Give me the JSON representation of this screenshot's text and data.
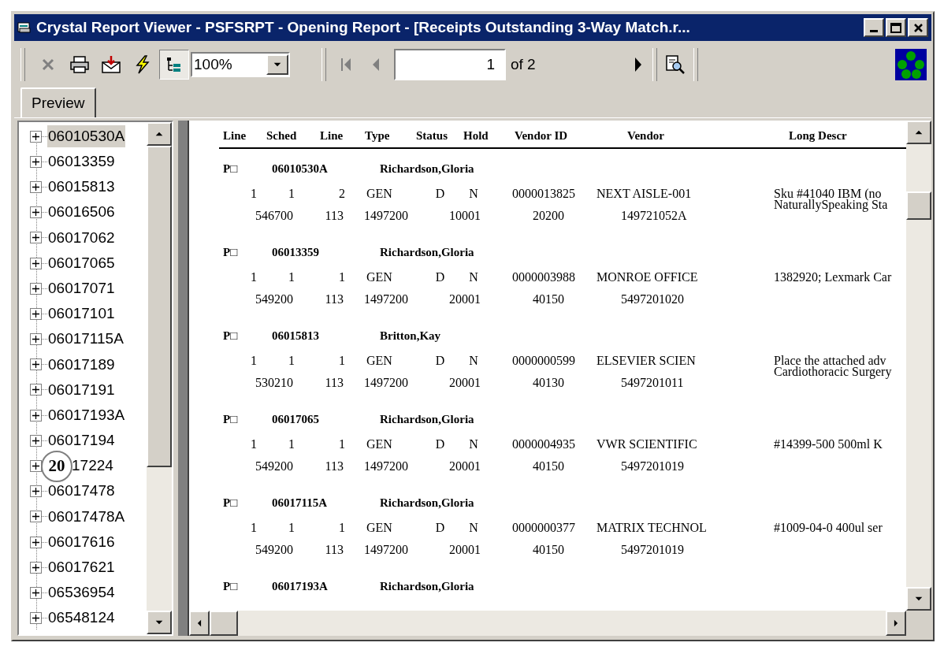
{
  "window": {
    "title": "Crystal Report Viewer - PSFSRPT - Opening Report - [Receipts Outstanding 3-Way Match.r..."
  },
  "toolbar": {
    "buttons": [
      {
        "kind": "close",
        "disabled": true,
        "pressed": false
      },
      {
        "kind": "print",
        "disabled": false,
        "pressed": false
      },
      {
        "kind": "export",
        "disabled": false,
        "pressed": false
      },
      {
        "kind": "refresh",
        "disabled": false,
        "pressed": false
      },
      {
        "kind": "tree",
        "disabled": false,
        "pressed": true
      }
    ],
    "zoom": "100%",
    "first_disabled": true,
    "prev_disabled": true,
    "page": "1",
    "page_count": "of 2",
    "next_disabled": false
  },
  "tabs": [
    {
      "label": "Preview",
      "selected": true
    }
  ],
  "tree": {
    "items": [
      {
        "label": "06010530A",
        "selected": true
      },
      {
        "label": "06013359",
        "selected": false
      },
      {
        "label": "06015813",
        "selected": false
      },
      {
        "label": "06016506",
        "selected": false
      },
      {
        "label": "06017062",
        "selected": false
      },
      {
        "label": "06017065",
        "selected": false
      },
      {
        "label": "06017071",
        "selected": false
      },
      {
        "label": "06017101",
        "selected": false
      },
      {
        "label": "06017115A",
        "selected": false
      },
      {
        "label": "06017189",
        "selected": false
      },
      {
        "label": "06017191",
        "selected": false
      },
      {
        "label": "06017193A",
        "selected": false
      },
      {
        "label": "06017194",
        "selected": false
      },
      {
        "label": "17224",
        "selected": false,
        "callout": "20"
      },
      {
        "label": "06017478",
        "selected": false
      },
      {
        "label": "06017478A",
        "selected": false
      },
      {
        "label": "06017616",
        "selected": false
      },
      {
        "label": "06017621",
        "selected": false
      },
      {
        "label": "06536954",
        "selected": false
      },
      {
        "label": "06548124",
        "selected": false
      }
    ]
  },
  "report": {
    "columns": [
      "Line",
      "Sched",
      "Line",
      "Type",
      "Status",
      "Hold",
      "Vendor ID",
      "Vendor",
      "Long Descr"
    ],
    "groups": [
      {
        "po_label": "P□",
        "po": "06010530A",
        "buyer": "Richardson,Gloria",
        "line1": [
          "1",
          "1",
          "2",
          "GEN",
          "D",
          "N",
          "0000013825",
          "NEXT AISLE-001",
          "Sku #41040  IBM (no"
        ],
        "line2": [
          "546700",
          "113",
          "1497200",
          "10001",
          "20200",
          "149721052A",
          "NaturallySpeaking Sta"
        ]
      },
      {
        "po_label": "P□",
        "po": "06013359",
        "buyer": "Richardson,Gloria",
        "line1": [
          "1",
          "1",
          "1",
          "GEN",
          "D",
          "N",
          "0000003988",
          "MONROE OFFICE",
          "1382920; Lexmark Car"
        ],
        "line2": [
          "549200",
          "113",
          "1497200",
          "20001",
          "40150",
          "5497201020"
        ]
      },
      {
        "po_label": "P□",
        "po": "06015813",
        "buyer": "Britton,Kay",
        "line1": [
          "1",
          "1",
          "1",
          "GEN",
          "D",
          "N",
          "0000000599",
          "ELSEVIER SCIEN",
          "Place the attached adv"
        ],
        "line2": [
          "530210",
          "113",
          "1497200",
          "20001",
          "40130",
          "5497201011",
          "Cardiothoracic Surgery"
        ]
      },
      {
        "po_label": "P□",
        "po": "06017065",
        "buyer": "Richardson,Gloria",
        "line1": [
          "1",
          "1",
          "1",
          "GEN",
          "D",
          "N",
          "0000004935",
          "VWR SCIENTIFIC",
          "#14399-500   500ml K"
        ],
        "line2": [
          "549200",
          "113",
          "1497200",
          "20001",
          "40150",
          "5497201019"
        ]
      },
      {
        "po_label": "P□",
        "po": "06017115A",
        "buyer": "Richardson,Gloria",
        "line1": [
          "1",
          "1",
          "1",
          "GEN",
          "D",
          "N",
          "0000000377",
          "MATRIX TECHNOL",
          "#1009-04-0  400ul ser"
        ],
        "line2": [
          "549200",
          "113",
          "1497200",
          "20001",
          "40150",
          "5497201019"
        ]
      },
      {
        "po_label": "P□",
        "po": "06017193A",
        "buyer": "Richardson,Gloria"
      }
    ]
  }
}
